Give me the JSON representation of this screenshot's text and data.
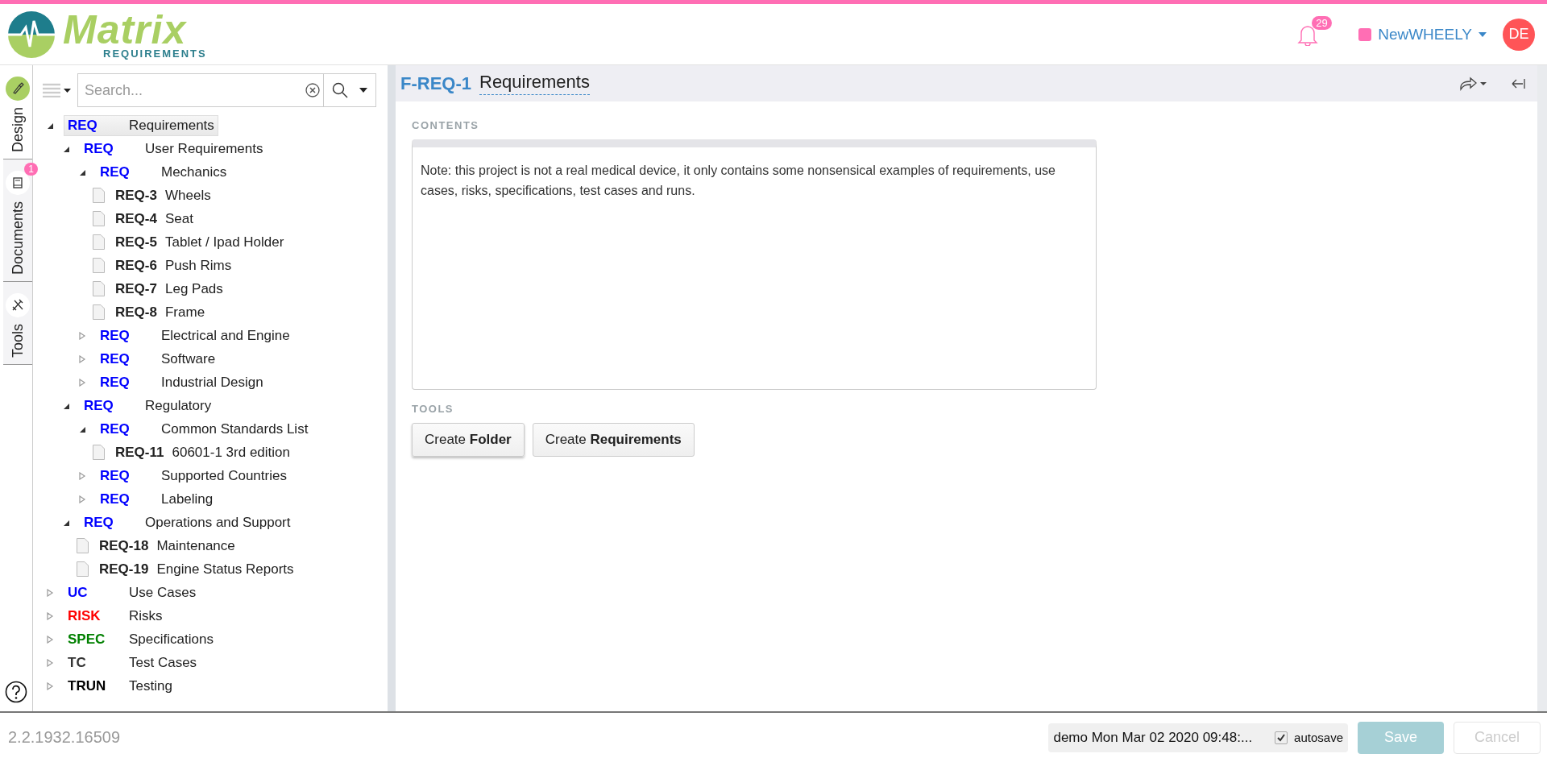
{
  "header": {
    "logo": {
      "name": "Matrix",
      "tagline": "REQUIREMENTS"
    },
    "notifications": {
      "count": "29"
    },
    "project": {
      "name": "NewWHEELY",
      "color": "#ff6eb4"
    },
    "user": {
      "initials": "DE"
    }
  },
  "side_tabs": [
    {
      "label": "Design",
      "selected": true,
      "kind": "design"
    },
    {
      "label": "Documents",
      "selected": false,
      "kind": "documents",
      "badge": "1"
    },
    {
      "label": "Tools",
      "selected": false,
      "kind": "tools"
    }
  ],
  "tree": {
    "search": {
      "placeholder": "Search..."
    },
    "nodes": [
      {
        "kind": "folder",
        "prefix": "REQ",
        "title": "Requirements",
        "color": "#0000ff",
        "expanded": true,
        "selected": true,
        "children": [
          {
            "kind": "folder",
            "prefix": "REQ",
            "title": "User Requirements",
            "color": "#0000ff",
            "expanded": true,
            "selected": false,
            "children": [
              {
                "kind": "folder",
                "prefix": "REQ",
                "title": "Mechanics",
                "color": "#0000ff",
                "expanded": true,
                "selected": false,
                "children": [
                  {
                    "kind": "item",
                    "prefix": "REQ-3",
                    "title": "Wheels",
                    "selected": false
                  },
                  {
                    "kind": "item",
                    "prefix": "REQ-4",
                    "title": "Seat",
                    "selected": false
                  },
                  {
                    "kind": "item",
                    "prefix": "REQ-5",
                    "title": "Tablet / Ipad Holder",
                    "selected": false
                  },
                  {
                    "kind": "item",
                    "prefix": "REQ-6",
                    "title": "Push Rims",
                    "selected": false
                  },
                  {
                    "kind": "item",
                    "prefix": "REQ-7",
                    "title": "Leg Pads",
                    "selected": false
                  },
                  {
                    "kind": "item",
                    "prefix": "REQ-8",
                    "title": "Frame",
                    "selected": false
                  }
                ]
              },
              {
                "kind": "folder",
                "prefix": "REQ",
                "title": "Electrical and Engine",
                "color": "#0000ff",
                "expanded": false,
                "selected": false
              },
              {
                "kind": "folder",
                "prefix": "REQ",
                "title": "Software",
                "color": "#0000ff",
                "expanded": false,
                "selected": false
              },
              {
                "kind": "folder",
                "prefix": "REQ",
                "title": "Industrial Design",
                "color": "#0000ff",
                "expanded": false,
                "selected": false
              }
            ]
          },
          {
            "kind": "folder",
            "prefix": "REQ",
            "title": "Regulatory",
            "color": "#0000ff",
            "expanded": true,
            "selected": false,
            "children": [
              {
                "kind": "folder",
                "prefix": "REQ",
                "title": "Common Standards List",
                "color": "#0000ff",
                "expanded": true,
                "selected": false,
                "children": [
                  {
                    "kind": "item",
                    "prefix": "REQ-11",
                    "title": "60601-1 3rd edition",
                    "selected": false
                  }
                ]
              },
              {
                "kind": "folder",
                "prefix": "REQ",
                "title": "Supported Countries",
                "color": "#0000ff",
                "expanded": false,
                "selected": false
              },
              {
                "kind": "folder",
                "prefix": "REQ",
                "title": "Labeling",
                "color": "#0000ff",
                "expanded": false,
                "selected": false
              }
            ]
          },
          {
            "kind": "folder",
            "prefix": "REQ",
            "title": "Operations and Support",
            "color": "#0000ff",
            "expanded": true,
            "selected": false,
            "children": [
              {
                "kind": "item",
                "prefix": "REQ-18",
                "title": "Maintenance",
                "selected": false
              },
              {
                "kind": "item",
                "prefix": "REQ-19",
                "title": "Engine Status Reports",
                "selected": false
              }
            ]
          }
        ]
      },
      {
        "kind": "folder",
        "prefix": "UC",
        "title": "Use Cases",
        "color": "#0000ff",
        "expanded": false,
        "selected": false
      },
      {
        "kind": "folder",
        "prefix": "RISK",
        "title": "Risks",
        "color": "#ff0000",
        "expanded": false,
        "selected": false
      },
      {
        "kind": "folder",
        "prefix": "SPEC",
        "title": "Specifications",
        "color": "#008000",
        "expanded": false,
        "selected": false
      },
      {
        "kind": "folder",
        "prefix": "TC",
        "title": "Test Cases",
        "color": "#333333",
        "expanded": false,
        "selected": false
      },
      {
        "kind": "folder",
        "prefix": "TRUN",
        "title": "Testing",
        "color": "#000000",
        "expanded": false,
        "selected": false
      }
    ]
  },
  "item": {
    "id": "F-REQ-1",
    "title": "Requirements",
    "contents": {
      "label": "CONTENTS",
      "text": "Note: this project is not a real medical device, it only contains some nonsensical examples of requirements, use cases, risks, specifications, test cases and runs."
    },
    "tools": {
      "label": "TOOLS",
      "buttons": [
        {
          "text": "Create **Folder**"
        },
        {
          "text": "Create **Requirements**"
        }
      ]
    }
  },
  "footer": {
    "version": "2.2.1932.16509",
    "status": "demo Mon Mar 02 2020 09:48:...",
    "autosave": {
      "label": "autosave",
      "checked": true
    },
    "save": {
      "label": "Save",
      "disabled": true
    },
    "cancel": {
      "label": "Cancel",
      "disabled": true
    }
  }
}
